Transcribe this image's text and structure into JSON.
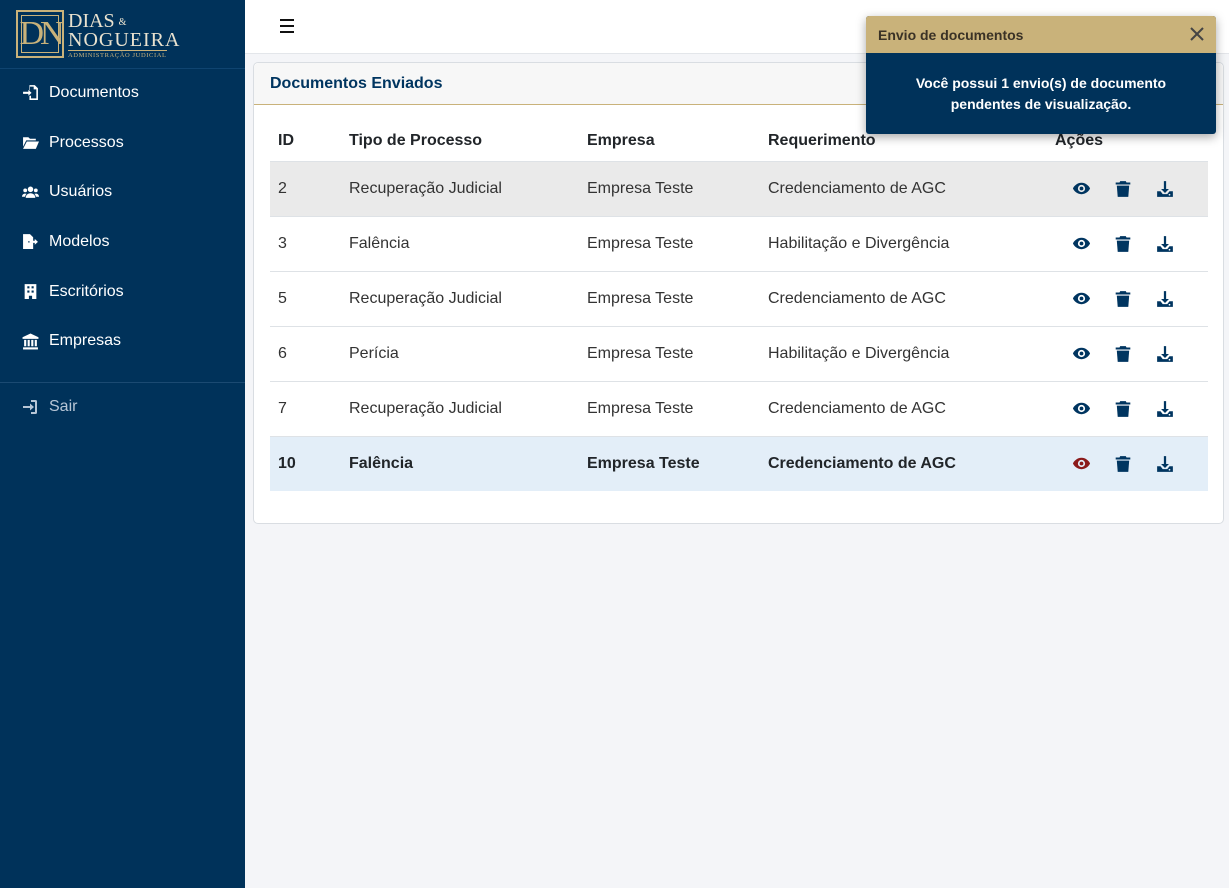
{
  "brand": {
    "monogram": "DN",
    "line1": "DIAS",
    "amp": "&",
    "line2": "NOGUEIRA",
    "line3": "ADMINISTRAÇÃO JUDICIAL",
    "accent_color": "#c9b27a",
    "sidebar_color": "#00325a"
  },
  "sidebar": {
    "items": [
      {
        "label": "Documentos",
        "icon": "file-import-icon"
      },
      {
        "label": "Processos",
        "icon": "folder-open-icon"
      },
      {
        "label": "Usuários",
        "icon": "users-icon"
      },
      {
        "label": "Modelos",
        "icon": "file-export-icon"
      },
      {
        "label": "Escritórios",
        "icon": "building-icon"
      },
      {
        "label": "Empresas",
        "icon": "landmark-icon"
      }
    ],
    "logout": {
      "label": "Sair",
      "icon": "sign-in-icon"
    }
  },
  "topbar": {
    "menu_icon": "hamburger-menu-icon"
  },
  "card": {
    "title": "Documentos Enviados",
    "columns": [
      "ID",
      "Tipo de Processo",
      "Empresa",
      "Requerimento",
      "Ações"
    ],
    "rows": [
      {
        "id": "2",
        "tipo": "Recuperação Judicial",
        "empresa": "Empresa Teste",
        "requerimento": "Credenciamento de AGC"
      },
      {
        "id": "3",
        "tipo": "Falência",
        "empresa": "Empresa Teste",
        "requerimento": "Habilitação e Divergência"
      },
      {
        "id": "5",
        "tipo": "Recuperação Judicial",
        "empresa": "Empresa Teste",
        "requerimento": "Credenciamento de AGC"
      },
      {
        "id": "6",
        "tipo": "Perícia",
        "empresa": "Empresa Teste",
        "requerimento": "Habilitação e Divergência"
      },
      {
        "id": "7",
        "tipo": "Recuperação Judicial",
        "empresa": "Empresa Teste",
        "requerimento": "Credenciamento de AGC"
      },
      {
        "id": "10",
        "tipo": "Falência",
        "empresa": "Empresa Teste",
        "requerimento": "Credenciamento de AGC"
      }
    ],
    "action_icons": [
      "eye-icon",
      "trash-icon",
      "download-icon"
    ],
    "unread_eye_color": "#8b1a1a",
    "action_color": "#003560"
  },
  "toast": {
    "title": "Envio de documentos",
    "message": "Você possui 1 envio(s) de documento pendentes de visualização.",
    "header_color": "#c9b27a",
    "body_color": "#00325a"
  }
}
